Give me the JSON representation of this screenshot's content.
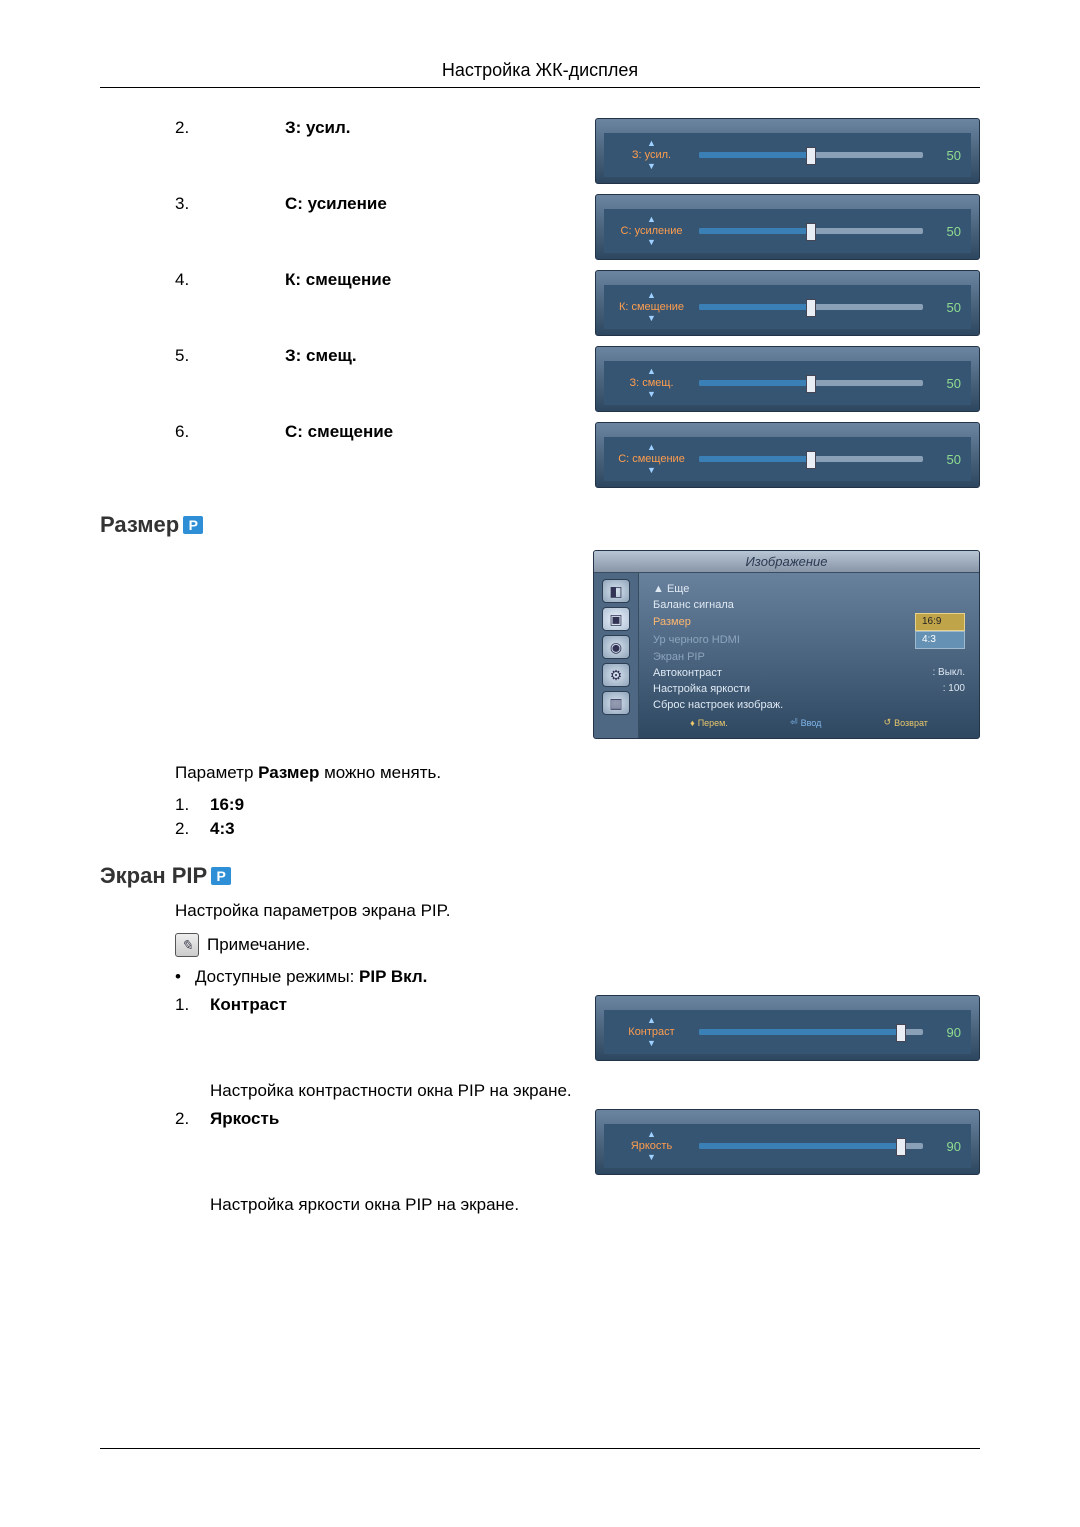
{
  "header": {
    "title": "Настройка ЖК-дисплея"
  },
  "gain_items": [
    {
      "num": "2.",
      "label": "З: усил.",
      "slider_label": "З: усил.",
      "value": "50",
      "pct": 50
    },
    {
      "num": "3.",
      "label": "С: усиление",
      "slider_label": "С: усиление",
      "value": "50",
      "pct": 50
    },
    {
      "num": "4.",
      "label": "К: смещение",
      "slider_label": "К: смещение",
      "value": "50",
      "pct": 50
    },
    {
      "num": "5.",
      "label": "З: смещ.",
      "slider_label": "З: смещ.",
      "value": "50",
      "pct": 50
    },
    {
      "num": "6.",
      "label": "С: смещение",
      "slider_label": "С: смещение",
      "value": "50",
      "pct": 50
    }
  ],
  "size_section": {
    "heading": "Размер",
    "osd": {
      "title": "Изображение",
      "lines": {
        "more": "▲ Еще",
        "balance": "Баланс сигнала",
        "size_label": "Размер",
        "size_val": "16:9",
        "hdmi_label": "Ур черного HDMI",
        "hdmi_val": "4:3",
        "pip_label": "Экран PIP",
        "autocontrast_label": "Автоконтраст",
        "autocontrast_val": ": Выкл.",
        "bright_label": "Настройка яркости",
        "bright_val": ": 100",
        "reset_label": "Сброс настроек изображ."
      },
      "footer": {
        "move": "Перем.",
        "enter": "Ввод",
        "back": "Возврат"
      }
    },
    "desc_prefix": "Параметр ",
    "desc_bold": "Размер",
    "desc_suffix": " можно менять.",
    "options": [
      {
        "num": "1.",
        "label": "16:9"
      },
      {
        "num": "2.",
        "label": "4:3"
      }
    ]
  },
  "pip_section": {
    "heading": "Экран PIP",
    "intro": "Настройка параметров экрана PIP.",
    "note_label": "Примечание.",
    "modes_prefix": "Доступные режимы: ",
    "modes_bold": "PIP Вкл.",
    "items": [
      {
        "num": "1.",
        "label": "Контраст",
        "slider_label": "Контраст",
        "value": "90",
        "pct": 90,
        "desc": "Настройка контрастности окна PIP на экране."
      },
      {
        "num": "2.",
        "label": "Яркость",
        "slider_label": "Яркость",
        "value": "90",
        "pct": 90,
        "desc": "Настройка яркости окна PIP на экране."
      }
    ]
  }
}
